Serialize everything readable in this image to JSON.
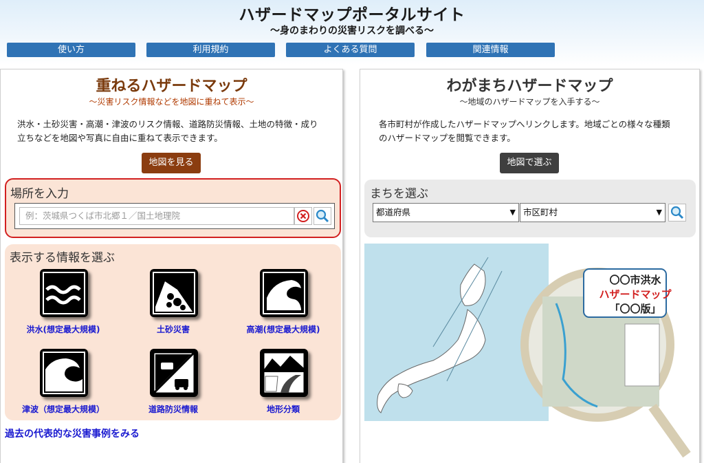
{
  "header": {
    "title": "ハザードマップポータルサイト",
    "subtitle": "〜身のまわりの災害リスクを調べる〜",
    "nav": [
      "使い方",
      "利用規約",
      "よくある質問",
      "関連情報"
    ]
  },
  "left": {
    "title": "重ねるハザードマップ",
    "subtitle": "〜災害リスク情報などを地図に重ねて表示〜",
    "description_line1": "洪水・土砂災害・高潮・津波のリスク情報、道路防災情報、土地の特徴・成り",
    "description_line2": "立ちなどを地図や写真に自由に重ねて表示できます。",
    "map_button": "地図を見る",
    "place_label": "場所を入力",
    "search_placeholder": "例：茨城県つくば市北郷１／国土地理院",
    "info_label": "表示する情報を選ぶ",
    "hazards": [
      "洪水(想定最大規模)",
      "土砂災害",
      "高潮(想定最大規模)",
      "津波（想定最大規模）",
      "道路防災情報",
      "地形分類"
    ],
    "past_link": "過去の代表的な災害事例をみる"
  },
  "right": {
    "title": "わがまちハザードマップ",
    "subtitle": "〜地域のハザードマップを入手する〜",
    "description_line1": "各市町村が作成したハザードマップへリンクします。地域ごとの様々な種類",
    "description_line2": "のハザードマップを閲覧できます。",
    "map_button": "地図で選ぶ",
    "town_label": "まちを選ぶ",
    "prefecture_select": "都道府県",
    "city_select": "市区町村",
    "sample_map_title_line1": "〇〇市洪水",
    "sample_map_title_line2": "ハザードマップ",
    "sample_map_title_line3": "「〇〇版」"
  },
  "colors": {
    "nav_blue": "#2f73b5",
    "left_title": "#7a3a0c",
    "left_subtitle": "#b03a00",
    "peach_bg": "#fbe4d6",
    "highlight_red": "#d22020",
    "link_blue": "#1a1ad0"
  }
}
